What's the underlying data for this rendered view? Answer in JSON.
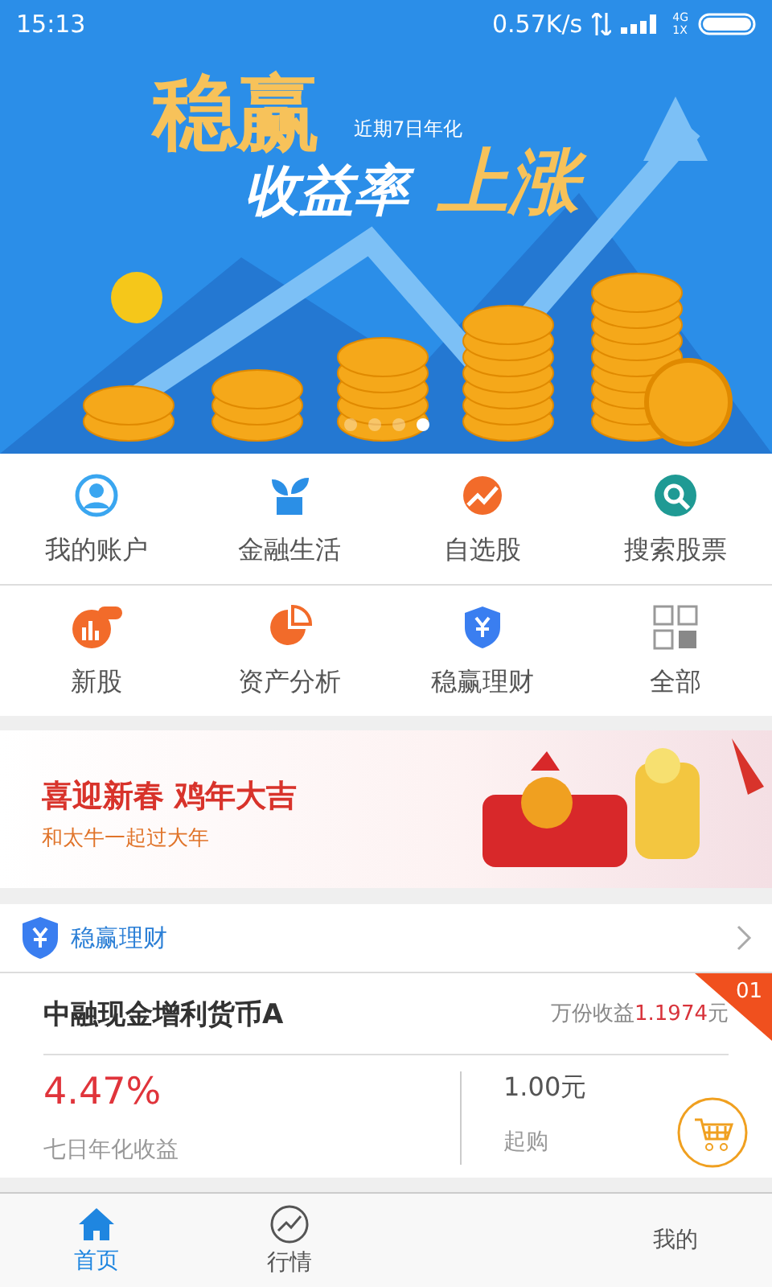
{
  "status_bar": {
    "time": "15:13",
    "speed": "0.57K/s",
    "network_top": "4G",
    "network_bottom": "1X"
  },
  "banner": {
    "title": "稳赢",
    "subtitle": "近期7日年化",
    "line_left": "收益率",
    "line_right": "上涨",
    "dots": [
      {
        "selected": false
      },
      {
        "selected": false
      },
      {
        "selected": false
      },
      {
        "selected": true
      }
    ]
  },
  "menu": [
    {
      "label": "我的账户"
    },
    {
      "label": "金融生活"
    },
    {
      "label": "自选股"
    },
    {
      "label": "搜索股票"
    },
    {
      "label": "新股"
    },
    {
      "label": "资产分析"
    },
    {
      "label": "稳赢理财"
    },
    {
      "label": "全部"
    }
  ],
  "promo": {
    "headline": "喜迎新春 鸡年大吉",
    "subline": "和太牛一起过大年"
  },
  "section": {
    "title": "稳赢理财"
  },
  "product": {
    "rank": "01",
    "name": "中融现金增利货币A",
    "yield_label": "万份收益",
    "yield_value": "1.1974",
    "yield_unit": "元",
    "rate": "4.47%",
    "rate_label": "七日年化收益",
    "min_amount": "1.00元",
    "min_label": "起购"
  },
  "tab_bar": [
    {
      "label": "首页",
      "selected": true
    },
    {
      "label": "行情",
      "selected": false
    },
    {
      "label": "我的",
      "selected": false
    }
  ]
}
